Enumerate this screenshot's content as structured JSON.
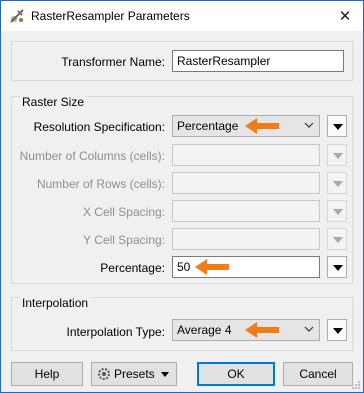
{
  "window": {
    "title": "RasterResampler Parameters",
    "close_glyph": "✕",
    "app_icon": "fme-transformer-icon"
  },
  "transformer": {
    "label": "Transformer Name:",
    "value": "RasterResampler"
  },
  "raster_size": {
    "group_title": "Raster Size",
    "resolution": {
      "label": "Resolution Specification:",
      "value": "Percentage"
    },
    "columns": {
      "label": "Number of Columns (cells):",
      "value": ""
    },
    "rows": {
      "label": "Number of Rows (cells):",
      "value": ""
    },
    "x_spacing": {
      "label": "X Cell Spacing:",
      "value": ""
    },
    "y_spacing": {
      "label": "Y Cell Spacing:",
      "value": ""
    },
    "percentage": {
      "label": "Percentage:",
      "value": "50"
    }
  },
  "interpolation": {
    "group_title": "Interpolation",
    "type": {
      "label": "Interpolation Type:",
      "value": "Average 4"
    }
  },
  "buttons": {
    "help": "Help",
    "presets": "Presets",
    "ok": "OK",
    "cancel": "Cancel"
  },
  "colors": {
    "arrow": "#f07d19",
    "accent": "#0078d7",
    "window_border": "#1e66c8"
  }
}
